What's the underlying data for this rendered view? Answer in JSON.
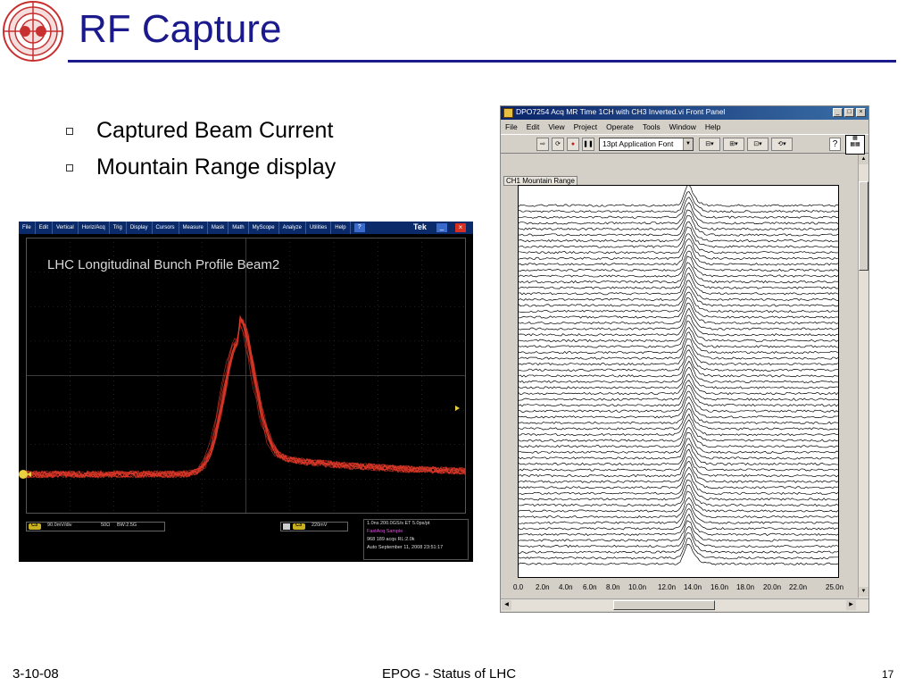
{
  "slide": {
    "title": "RF Capture",
    "bullets": [
      "Captured Beam Current",
      "Mountain Range display"
    ]
  },
  "footer": {
    "date": "3-10-08",
    "center": "EPOG - Status of LHC",
    "page": "17"
  },
  "scope": {
    "menus": [
      "File",
      "Edit",
      "Vertical",
      "Horiz/Acq",
      "Trig",
      "Display",
      "Cursors",
      "Measure",
      "Mask",
      "Math",
      "MyScope",
      "Analyze",
      "Utilities",
      "Help"
    ],
    "brand": "Tek",
    "plot_title": "LHC Longitudinal Bunch Profile Beam2",
    "channel_badge": "C3",
    "channel_scale": "90.0mV/div",
    "impedance": "50Ω",
    "bandwidth": "BW:2.5G",
    "trigger_badge": "C3",
    "trigger_level": "220mV",
    "acq_lines": [
      "1.0ns    200.0GS/s   ET   5.0ps/pt",
      "FastAcq   Sample",
      "968 189 acqs              RL:2.0k",
      "Auto    September 11, 2008   23:51:17"
    ],
    "trace_color": "#e03a2a"
  },
  "labview": {
    "window_title": "DPO7254 Acq MR Time 1CH with CH3 Inverted.vi Front Panel",
    "menus": [
      "File",
      "Edit",
      "View",
      "Project",
      "Operate",
      "Tools",
      "Window",
      "Help"
    ],
    "font_select": "13pt Application Font",
    "graph_label": "CH1 Mountain Range",
    "x_ticks": [
      "0.0",
      "2.0n",
      "4.0n",
      "6.0n",
      "8.0n",
      "10.0n",
      "12.0n",
      "14.0n",
      "16.0n",
      "18.0n",
      "20.0n",
      "22.0n",
      "25.0n"
    ]
  }
}
